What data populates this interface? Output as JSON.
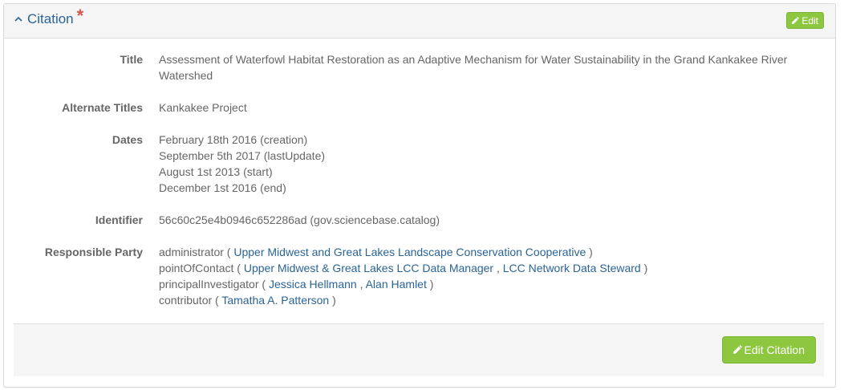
{
  "panel": {
    "title": "Citation",
    "required_marker": "*",
    "edit_label": "Edit",
    "footer_button_label": "Edit Citation"
  },
  "fields": {
    "title": {
      "label": "Title",
      "value": "Assessment of Waterfowl Habitat Restoration as an Adaptive Mechanism for Water Sustainability in the Grand Kankakee River Watershed"
    },
    "alternate_titles": {
      "label": "Alternate Titles",
      "value": "Kankakee Project"
    },
    "dates": {
      "label": "Dates",
      "items": [
        "February 18th 2016 (creation)",
        "September 5th 2017 (lastUpdate)",
        "August 1st 2013 (start)",
        "December 1st 2016 (end)"
      ]
    },
    "identifier": {
      "label": "Identifier",
      "value": "56c60c25e4b0946c652286ad (gov.sciencebase.catalog)"
    },
    "responsible_party": {
      "label": "Responsible Party",
      "roles": [
        {
          "role": "administrator",
          "open": " ( ",
          "parties": [
            "Upper Midwest and Great Lakes Landscape Conservation Cooperative"
          ],
          "close": " )"
        },
        {
          "role": "pointOfContact",
          "open": " ( ",
          "parties": [
            "Upper Midwest & Great Lakes LCC Data Manager",
            "LCC Network Data Steward"
          ],
          "close": " )"
        },
        {
          "role": "principalInvestigator",
          "open": " ( ",
          "parties": [
            "Jessica Hellmann",
            "Alan Hamlet"
          ],
          "close": " )"
        },
        {
          "role": "contributor",
          "open": " ( ",
          "parties": [
            "Tamatha A. Patterson"
          ],
          "close": " )"
        }
      ],
      "separator": " , "
    }
  },
  "colors": {
    "link": "#2a6496",
    "button_green": "#8dc63f",
    "required_red": "#d9534f",
    "label_gray": "#666666"
  },
  "icons": {
    "collapse": "chevron-up-icon",
    "edit": "pencil-icon"
  }
}
